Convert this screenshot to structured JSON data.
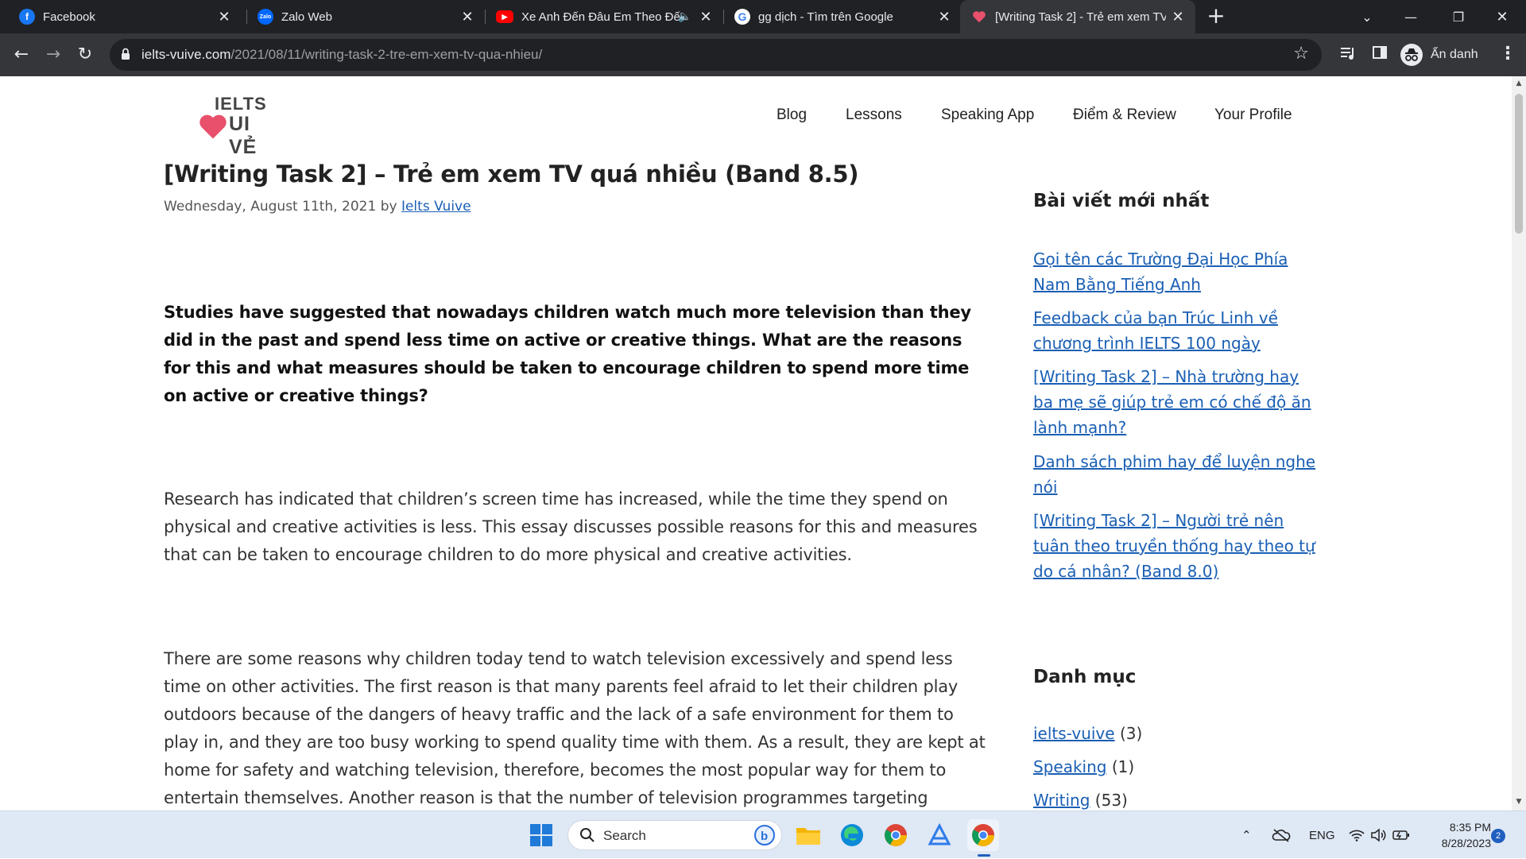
{
  "browser": {
    "tabs": [
      {
        "title": "Facebook",
        "icon": "facebook-icon",
        "color": "#1877f2"
      },
      {
        "title": "Zalo Web",
        "icon": "zalo-icon",
        "color": "#0068ff"
      },
      {
        "title": "Xe Anh Đến Đâu Em Theo Đế",
        "icon": "youtube-icon",
        "color": "#ff0000"
      },
      {
        "title": "gg dịch - Tìm trên Google",
        "icon": "google-icon",
        "color": "#4285f4"
      },
      {
        "title": "[Writing Task 2] - Trẻ em xem TV",
        "icon": "heart-icon",
        "color": "#e8506b",
        "active": true
      }
    ],
    "url_domain": "ielts-vuive.com",
    "url_path": "/2021/08/11/writing-task-2-tre-em-xem-tv-qua-nhieu/",
    "profile_label": "Ẩn danh"
  },
  "site": {
    "logo_line1": "IELTS",
    "logo_line2": "UI VẺ",
    "nav": [
      "Blog",
      "Lessons",
      "Speaking App",
      "Điểm & Review",
      "Your Profile"
    ]
  },
  "post": {
    "title": "[Writing Task 2] – Trẻ em xem TV quá nhiều (Band 8.5)",
    "date": "Wednesday, August 11th, 2021",
    "by": "by",
    "author": "Ielts Vuive",
    "prompt": "Studies have suggested that nowadays children watch much more television than they did in the past and spend less time on active or creative things. What are the reasons for this and what measures should be taken to encourage children to spend more time on active or creative things?",
    "paragraph1": "Research has indicated that children’s screen time has increased, while the time they spend on physical and creative activities is less. This essay discusses possible reasons for this and measures that can be taken to encourage children to do more physical and creative activities.",
    "paragraph2": "There are some reasons why children today tend to watch television excessively and spend less time on other activities. The first reason is that many parents feel afraid to let their children play outdoors because of the dangers of heavy traffic and the lack of a safe environment for them to play in, and they are too busy working to spend quality time with them. As a result, they are kept at home for safety and watching television, therefore, becomes the most popular way for them to entertain themselves. Another reason is that the number of television programmes targeting children has"
  },
  "sidebar": {
    "recent_heading": "Bài viết mới nhất",
    "recent_posts": [
      "Gọi tên các Trường Đại Học Phía Nam Bằng Tiếng Anh",
      "Feedback của bạn Trúc Linh về chương trình IELTS 100 ngày",
      "[Writing Task 2] – Nhà trường hay ba mẹ sẽ giúp trẻ em có chế độ ăn lành mạnh?",
      "Danh sách phim hay để luyện nghe nói",
      "[Writing Task 2] – Người trẻ nên tuân theo truyền thống hay theo tự do cá nhân? (Band 8.0)"
    ],
    "category_heading": "Danh mục",
    "categories": [
      {
        "name": "ielts-vuive",
        "count": "(3)"
      },
      {
        "name": "Speaking",
        "count": "(1)"
      },
      {
        "name": "Writing",
        "count": "(53)"
      }
    ]
  },
  "taskbar": {
    "search_label": "Search",
    "language": "ENG",
    "time": "8:35 PM",
    "date": "8/28/2023",
    "notification_count": "2"
  }
}
